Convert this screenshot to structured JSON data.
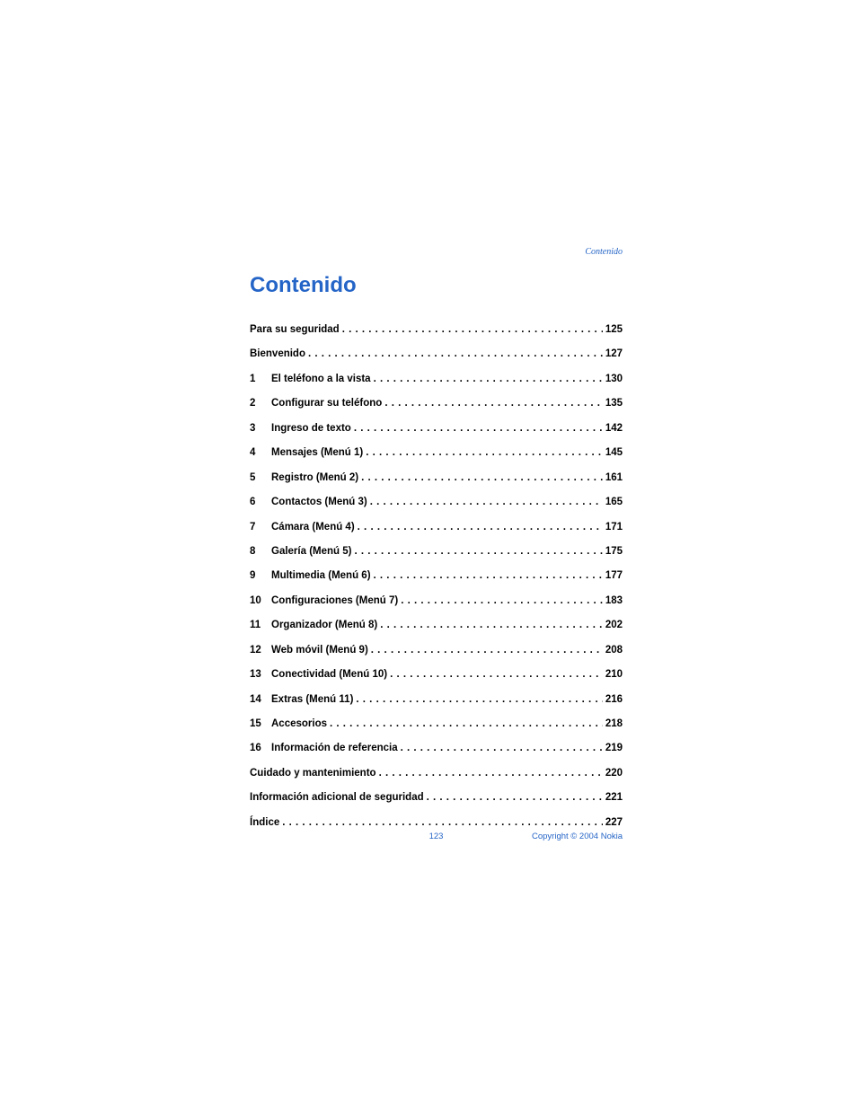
{
  "header_label": "Contenido",
  "title": "Contenido",
  "toc": [
    {
      "num": "",
      "label": "Para su seguridad",
      "page": "125",
      "indent": false
    },
    {
      "num": "",
      "label": "Bienvenido",
      "page": "127",
      "indent": false
    },
    {
      "num": "1",
      "label": "El teléfono a la vista",
      "page": "130",
      "indent": true
    },
    {
      "num": "2",
      "label": "Configurar su teléfono",
      "page": "135",
      "indent": true
    },
    {
      "num": "3",
      "label": "Ingreso de texto",
      "page": "142",
      "indent": true
    },
    {
      "num": "4",
      "label": "Mensajes (Menú 1)",
      "page": "145",
      "indent": true
    },
    {
      "num": "5",
      "label": "Registro (Menú 2)",
      "page": "161",
      "indent": true
    },
    {
      "num": "6",
      "label": "Contactos (Menú 3)",
      "page": "165",
      "indent": true
    },
    {
      "num": "7",
      "label": "Cámara (Menú 4)",
      "page": "171",
      "indent": true
    },
    {
      "num": "8",
      "label": "Galería (Menú 5)",
      "page": "175",
      "indent": true
    },
    {
      "num": "9",
      "label": "Multimedia (Menú 6)",
      "page": "177",
      "indent": true
    },
    {
      "num": "10",
      "label": "Configuraciones (Menú 7)",
      "page": "183",
      "indent": true
    },
    {
      "num": "11",
      "label": "Organizador (Menú 8)",
      "page": "202",
      "indent": true
    },
    {
      "num": "12",
      "label": "Web móvil (Menú 9)",
      "page": "208",
      "indent": true
    },
    {
      "num": "13",
      "label": "Conectividad (Menú 10)",
      "page": "210",
      "indent": true
    },
    {
      "num": "14",
      "label": "Extras (Menú 11)",
      "page": "216",
      "indent": true
    },
    {
      "num": "15",
      "label": "Accesorios",
      "page": "218",
      "indent": true
    },
    {
      "num": "16",
      "label": "Información de referencia",
      "page": "219",
      "indent": true
    },
    {
      "num": "",
      "label": "Cuidado y mantenimiento",
      "page": "220",
      "indent": false
    },
    {
      "num": "",
      "label": "Información adicional de seguridad",
      "page": "221",
      "indent": false
    },
    {
      "num": "",
      "label": "Índice",
      "page": "227",
      "indent": false
    }
  ],
  "footer": {
    "page_number": "123",
    "copyright": "Copyright © 2004 Nokia"
  }
}
